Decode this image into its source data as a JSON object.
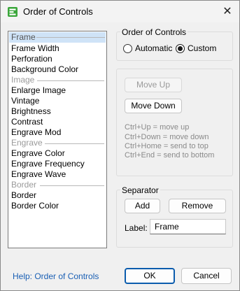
{
  "window": {
    "title": "Order of Controls",
    "close_glyph": "✕",
    "icon": "app-icon"
  },
  "list": {
    "items": [
      {
        "label": "Frame",
        "type": "separator",
        "selected": true
      },
      {
        "label": "Frame Width",
        "type": "item"
      },
      {
        "label": "Perforation",
        "type": "item"
      },
      {
        "label": "Background Color",
        "type": "item"
      },
      {
        "label": "Image",
        "type": "separator"
      },
      {
        "label": "Enlarge Image",
        "type": "item"
      },
      {
        "label": "Vintage",
        "type": "item"
      },
      {
        "label": "Brightness",
        "type": "item"
      },
      {
        "label": "Contrast",
        "type": "item"
      },
      {
        "label": "Engrave Mod",
        "type": "item"
      },
      {
        "label": "Engrave",
        "type": "separator"
      },
      {
        "label": "Engrave Color",
        "type": "item"
      },
      {
        "label": "Engrave Frequency",
        "type": "item"
      },
      {
        "label": "Engrave Wave",
        "type": "item"
      },
      {
        "label": "Border",
        "type": "separator"
      },
      {
        "label": "Border",
        "type": "item"
      },
      {
        "label": "Border Color",
        "type": "item"
      }
    ]
  },
  "order_group": {
    "caption": "Order of Controls",
    "automatic_label": "Automatic",
    "custom_label": "Custom",
    "selected": "custom"
  },
  "move_group": {
    "move_up_label": "Move Up",
    "move_down_label": "Move Down",
    "help_lines": [
      "Ctrl+Up = move up",
      "Ctrl+Down = move down",
      "Ctrl+Home = send to top",
      "Ctrl+End = send to bottom"
    ]
  },
  "separator_group": {
    "caption": "Separator",
    "add_label": "Add",
    "remove_label": "Remove",
    "label_caption": "Label:",
    "label_value": "Frame"
  },
  "footer": {
    "help_link": "Help: Order of Controls",
    "ok_label": "OK",
    "cancel_label": "Cancel"
  },
  "colors": {
    "selection": "#cfe3f7",
    "link": "#1a5fb4",
    "primary_border": "#0b5cad"
  }
}
